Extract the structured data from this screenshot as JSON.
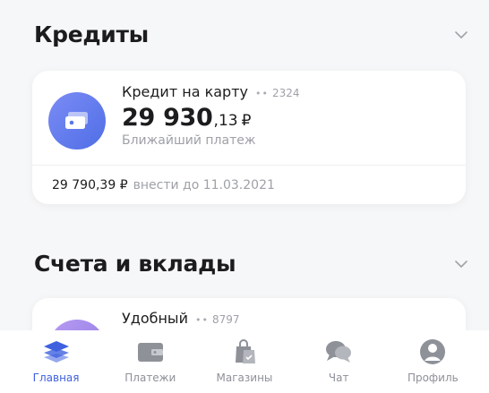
{
  "credits_section": {
    "title": "Кредиты",
    "card": {
      "name": "Кредит на карту",
      "mask_dots": "••",
      "mask_digits": "2324",
      "amount_main": "29 930",
      "amount_cents": ",13",
      "currency": "₽",
      "subtitle": "Ближайший платеж",
      "payment_amount": "29 790,39 ₽",
      "payment_text": "внести до 11.03.2021"
    }
  },
  "accounts_section": {
    "title": "Счета и вклады",
    "card": {
      "name": "Удобный",
      "mask_dots": "••",
      "mask_digits": "8797"
    }
  },
  "tabbar": {
    "tabs": [
      {
        "label": "Главная",
        "icon": "layers-icon",
        "active": true
      },
      {
        "label": "Платежи",
        "icon": "wallet-icon",
        "active": false
      },
      {
        "label": "Магазины",
        "icon": "shopping-bag-icon",
        "active": false
      },
      {
        "label": "Чат",
        "icon": "chat-icon",
        "active": false
      },
      {
        "label": "Профиль",
        "icon": "profile-icon",
        "active": false
      }
    ]
  },
  "colors": {
    "accent": "#3f61e0",
    "inactive": "#8e9198",
    "background": "#f6f7f8"
  }
}
